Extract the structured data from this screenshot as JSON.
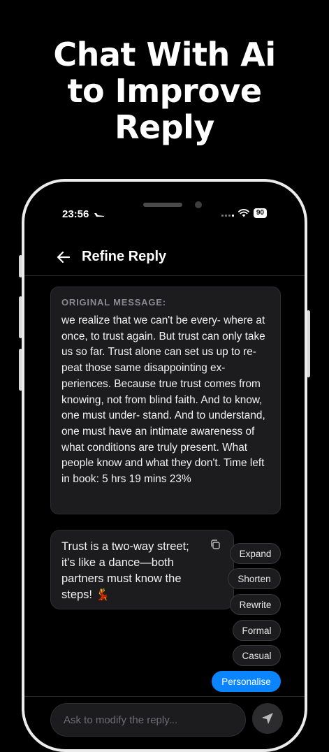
{
  "headline": {
    "line1": "Chat With Ai",
    "line2": "to Improve",
    "line3": "Reply"
  },
  "status_bar": {
    "time": "23:56",
    "battery": "90"
  },
  "nav": {
    "title": "Refine Reply"
  },
  "original_message": {
    "label": "ORIGINAL MESSAGE:",
    "text": "we realize that we can't be every- where at once, to trust again. But trust can only take us so far. Trust alone can set us up to re- peat those same disappointing ex- periences. Because true trust comes from knowing, not from blind faith. And to know, one must under- stand. And to understand, one must have an intimate awareness of what conditions are truly present. What people know and what they don't. Time left in book: 5 hrs 19 mins 23%"
  },
  "reply": {
    "text": "Trust is a two-way street; it's like a dance—both partners must know the steps! 💃"
  },
  "actions": {
    "expand": "Expand",
    "shorten": "Shorten",
    "rewrite": "Rewrite",
    "formal": "Formal",
    "casual": "Casual",
    "personalise": "Personalise"
  },
  "composer": {
    "placeholder": "Ask to modify the reply..."
  },
  "colors": {
    "accent": "#0a84ff",
    "card": "#1c1c1e",
    "background": "#000000"
  },
  "icons": {
    "back": "arrow-left-icon",
    "copy": "copy-icon",
    "send": "send-icon",
    "wifi": "wifi-icon",
    "signal": "signal-icon",
    "location": "location-icon"
  }
}
